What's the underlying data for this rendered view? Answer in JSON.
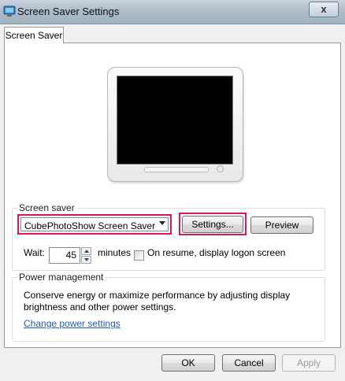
{
  "window": {
    "title": "Screen Saver Settings",
    "close_glyph": "x",
    "icon": "screen-saver-icon"
  },
  "tabs": [
    {
      "label": "Screen Saver",
      "active": true
    }
  ],
  "screen_saver": {
    "group_label": "Screen saver",
    "selected": "CubePhotoShow Screen Saver",
    "settings_label": "Settings...",
    "preview_label": "Preview",
    "wait_label": "Wait:",
    "wait_value": "45",
    "minutes_label": "minutes",
    "resume_label": "On resume, display logon screen",
    "resume_checked": false,
    "highlight_color": "#d6195a"
  },
  "power": {
    "group_label": "Power management",
    "description": "Conserve energy or maximize performance by adjusting display brightness and other power settings.",
    "link_label": "Change power settings"
  },
  "footer": {
    "ok_label": "OK",
    "cancel_label": "Cancel",
    "apply_label": "Apply"
  }
}
